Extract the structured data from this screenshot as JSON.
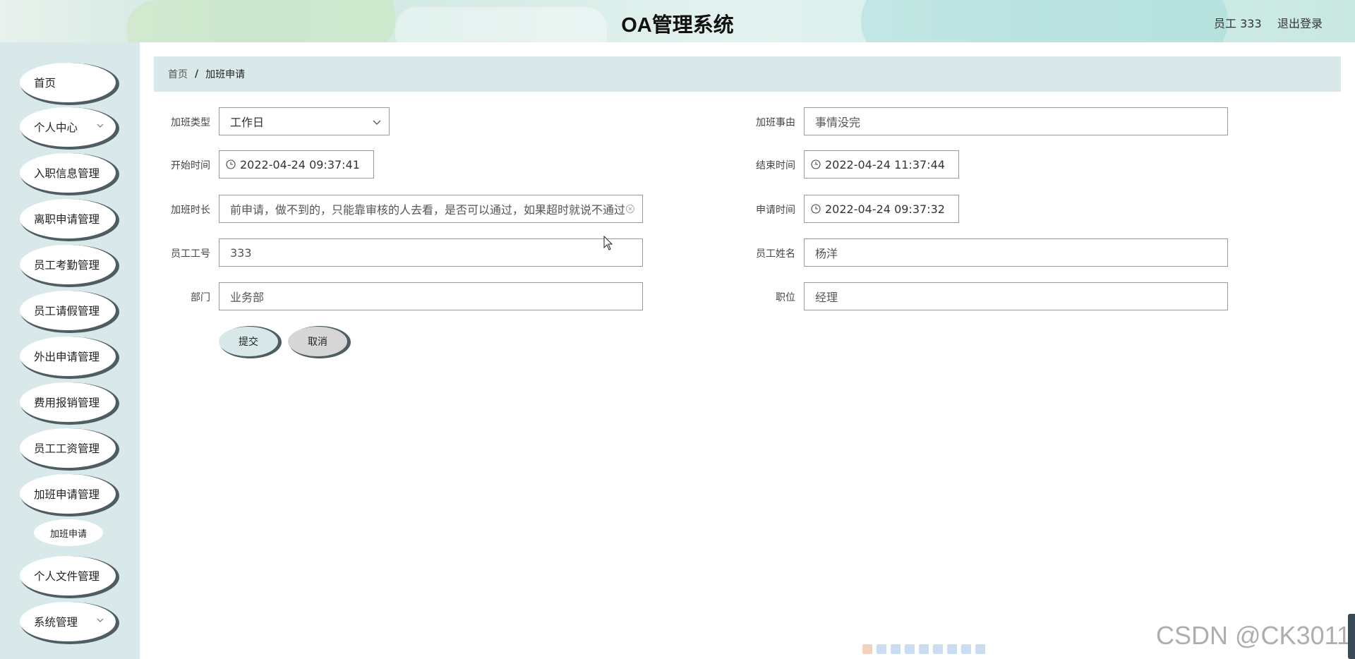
{
  "header": {
    "title": "OA管理系统",
    "user_label": "员工 333",
    "logout_label": "退出登录"
  },
  "sidebar": {
    "items": [
      {
        "label": "首页"
      },
      {
        "label": "个人中心"
      },
      {
        "label": "入职信息管理"
      },
      {
        "label": "离职申请管理"
      },
      {
        "label": "员工考勤管理"
      },
      {
        "label": "员工请假管理"
      },
      {
        "label": "外出申请管理"
      },
      {
        "label": "费用报销管理"
      },
      {
        "label": "员工工资管理"
      },
      {
        "label": "加班申请管理"
      },
      {
        "label": "个人文件管理"
      },
      {
        "label": "系统管理"
      }
    ],
    "sub_item": {
      "label": "加班申请"
    }
  },
  "breadcrumb": {
    "home": "首页",
    "separator": "/",
    "current": "加班申请"
  },
  "form": {
    "overtime_type": {
      "label": "加班类型",
      "value": "工作日"
    },
    "overtime_reason": {
      "label": "加班事由",
      "value": "事情没完"
    },
    "start_time": {
      "label": "开始时间",
      "value": "2022-04-24 09:37:41"
    },
    "end_time": {
      "label": "结束时间",
      "value": "2022-04-24 11:37:44"
    },
    "duration": {
      "label": "加班时长",
      "value": "前申请，做不到的，只能靠审核的人去看，是否可以通过，如果超时就说不通过"
    },
    "apply_time": {
      "label": "申请时间",
      "value": "2022-04-24 09:37:32"
    },
    "employee_id": {
      "label": "员工工号",
      "value": "333"
    },
    "employee_name": {
      "label": "员工姓名",
      "value": "杨洋"
    },
    "department": {
      "label": "部门",
      "value": "业务部"
    },
    "position": {
      "label": "职位",
      "value": "经理"
    }
  },
  "buttons": {
    "submit": "提交",
    "cancel": "取消"
  },
  "watermark": "CSDN @CK3011",
  "colors": {
    "sidebar_bg": "#d9e9ea",
    "button_shadow": "#4d5d62",
    "cancel_bg": "#d6d6d6"
  }
}
